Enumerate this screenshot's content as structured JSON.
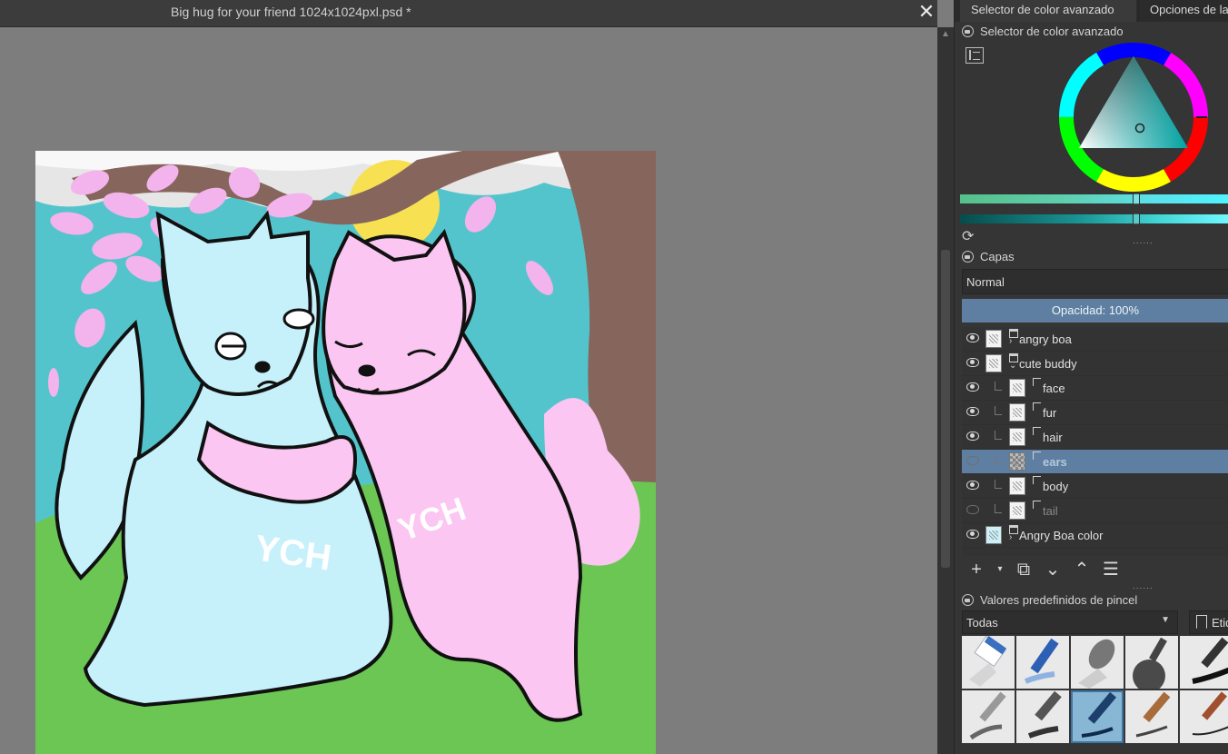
{
  "document": {
    "title": "Big hug for your friend 1024x1024pxl.psd *",
    "close_symbol": "✕"
  },
  "dock": {
    "tabs": [
      "Selector de color avanzado",
      "Opciones de la"
    ],
    "color_selector": {
      "title": "Selector de color avanzado",
      "current_color": "#58c7cb"
    },
    "layers": {
      "title": "Capas",
      "blend_mode": "Normal",
      "opacity_label": "Opacidad:",
      "opacity_value": "100%",
      "items": [
        {
          "name": "angry boa",
          "type": "group",
          "visible": true,
          "child": false,
          "selected": false
        },
        {
          "name": "cute buddy",
          "type": "group",
          "visible": true,
          "child": false,
          "selected": false
        },
        {
          "name": "face",
          "type": "paint",
          "visible": true,
          "child": true,
          "selected": false
        },
        {
          "name": "fur",
          "type": "paint",
          "visible": true,
          "child": true,
          "selected": false
        },
        {
          "name": "hair",
          "type": "paint",
          "visible": true,
          "child": true,
          "selected": false
        },
        {
          "name": "ears",
          "type": "paint",
          "visible": false,
          "child": true,
          "selected": true
        },
        {
          "name": "body",
          "type": "paint",
          "visible": true,
          "child": true,
          "selected": false
        },
        {
          "name": "tail",
          "type": "paint",
          "visible": false,
          "child": true,
          "selected": false
        },
        {
          "name": "Angry Boa color",
          "type": "group",
          "visible": true,
          "child": false,
          "selected": false
        }
      ]
    },
    "brush_presets": {
      "title": "Valores predefinidos de pincel",
      "filter": "Todas",
      "tag_label": "Etiq"
    }
  },
  "colors": {
    "sky": "#54c4cc",
    "grass": "#6cc653",
    "tree": "#86665c",
    "blossom": "#f3b3ec",
    "blue_cat": "#c6f1fb",
    "pink_cat": "#fbc6f2",
    "sun": "#f7e052",
    "clouds": "#e6e6e6",
    "selection": "#5e7fa1"
  },
  "artwork": {
    "text_left": "YCH",
    "text_right": "YCH"
  }
}
